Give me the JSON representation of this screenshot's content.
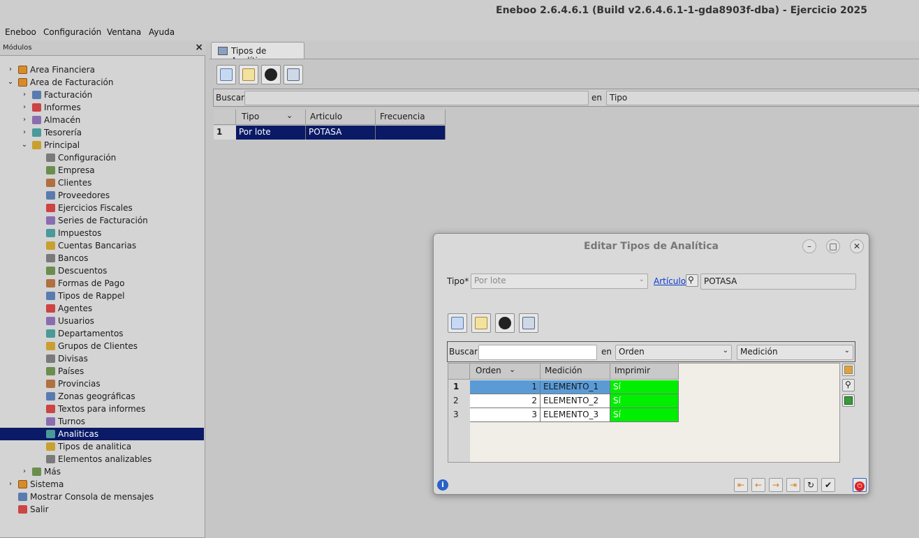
{
  "window": {
    "title": "Eneboo 2.6.4.6.1 (Build v2.6.4.6.1-1-gda8903f-dba) - Ejercicio 2025"
  },
  "menu": [
    {
      "label": "Eneboo"
    },
    {
      "label": "Configuración"
    },
    {
      "label": "Ventana"
    },
    {
      "label": "Ayuda"
    }
  ],
  "dock": {
    "title": "Módulos",
    "close": "×"
  },
  "tree": [
    {
      "label": "Area Financiera",
      "arrow": "›",
      "level": 0
    },
    {
      "label": "Area de Facturación",
      "arrow": "⌄",
      "level": 0
    },
    {
      "label": "Facturación",
      "arrow": "›",
      "level": 1
    },
    {
      "label": "Informes",
      "arrow": "›",
      "level": 1
    },
    {
      "label": "Almacén",
      "arrow": "›",
      "level": 1
    },
    {
      "label": "Tesorería",
      "arrow": "›",
      "level": 1
    },
    {
      "label": "Principal",
      "arrow": "⌄",
      "level": 1
    },
    {
      "label": "Configuración",
      "level": 2
    },
    {
      "label": "Empresa",
      "level": 2
    },
    {
      "label": "Clientes",
      "level": 2
    },
    {
      "label": "Proveedores",
      "level": 2
    },
    {
      "label": "Ejercicios Fiscales",
      "level": 2
    },
    {
      "label": "Series de Facturación",
      "level": 2
    },
    {
      "label": "Impuestos",
      "level": 2
    },
    {
      "label": "Cuentas Bancarias",
      "level": 2
    },
    {
      "label": "Bancos",
      "level": 2
    },
    {
      "label": "Descuentos",
      "level": 2
    },
    {
      "label": "Formas de Pago",
      "level": 2
    },
    {
      "label": "Tipos de Rappel",
      "level": 2
    },
    {
      "label": "Agentes",
      "level": 2
    },
    {
      "label": "Usuarios",
      "level": 2
    },
    {
      "label": "Departamentos",
      "level": 2
    },
    {
      "label": "Grupos de Clientes",
      "level": 2
    },
    {
      "label": "Divisas",
      "level": 2
    },
    {
      "label": "Países",
      "level": 2
    },
    {
      "label": "Provincias",
      "level": 2
    },
    {
      "label": "Zonas geográficas",
      "level": 2
    },
    {
      "label": "Textos para informes",
      "level": 2
    },
    {
      "label": "Turnos",
      "level": 2
    },
    {
      "label": "Analiticas",
      "level": 2,
      "selected": true
    },
    {
      "label": "Tipos de analitica",
      "level": 2
    },
    {
      "label": "Elementos analizables",
      "level": 2
    },
    {
      "label": "Más",
      "arrow": "›",
      "level": 1
    },
    {
      "label": "Sistema",
      "arrow": "›",
      "level": 0
    },
    {
      "label": "Mostrar Consola de mensajes",
      "level": 0
    },
    {
      "label": "Salir",
      "level": 0
    }
  ],
  "main": {
    "tab": "Tipos de Analítica",
    "search_label": "Buscar",
    "search_value": "",
    "en": "en",
    "search_field": "Tipo",
    "columns": [
      "Tipo",
      "Articulo",
      "Frecuencia"
    ],
    "rows": [
      {
        "num": "1",
        "tipo": "Por lote",
        "articulo": "POTASA",
        "frecuencia": ""
      }
    ]
  },
  "dialog": {
    "title": "Editar Tipos de Analítica",
    "tipo_label": "Tipo*",
    "tipo_value": "Por lote",
    "articulo_link": "Artículo",
    "articulo_value": "POTASA",
    "search_label": "Buscar",
    "search_value": "",
    "en": "en",
    "search_field": "Orden",
    "search_field2": "Medición",
    "columns": [
      "Orden",
      "Medición",
      "Imprimir"
    ],
    "rows": [
      {
        "num": "1",
        "orden": "1",
        "medicion": "ELEMENTO_1",
        "imprimir": "Sí"
      },
      {
        "num": "2",
        "orden": "2",
        "medicion": "ELEMENTO_2",
        "imprimir": "Sí"
      },
      {
        "num": "3",
        "orden": "3",
        "medicion": "ELEMENTO_3",
        "imprimir": "Sí"
      }
    ]
  },
  "colors": {
    "selection": "#0a1a66",
    "imprimir_bg": "#00ee00",
    "link": "#0b3bd0"
  }
}
